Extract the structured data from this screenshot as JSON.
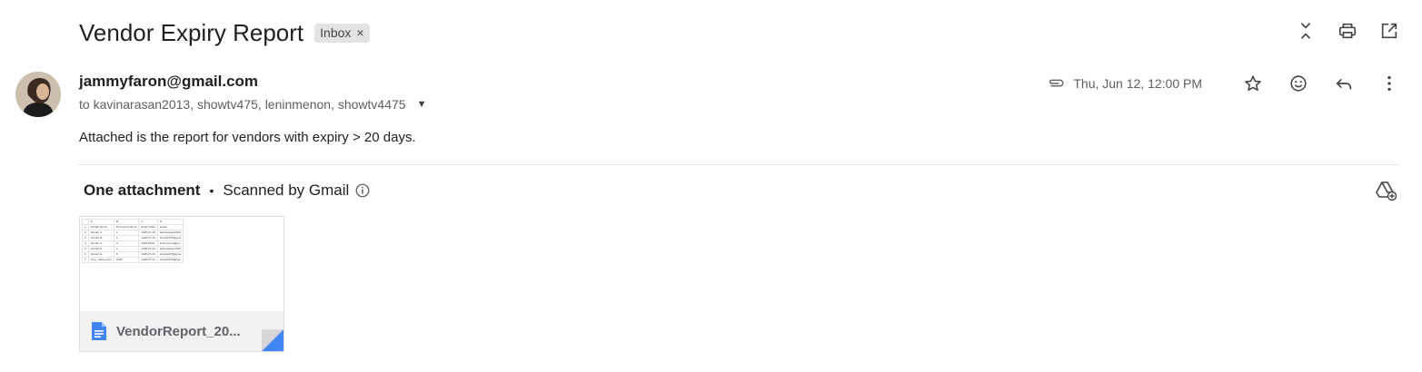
{
  "email": {
    "subject": "Vendor Expiry Report",
    "label": "Inbox",
    "label_remove": "×",
    "sender": "jammyfaron@gmail.com",
    "recipients": "to kavinarasan2013, showtv475, leninmenon, showtv4475",
    "date": "Thu, Jun 12, 12:00 PM",
    "body": "Attached is the report for vendors with expiry > 20 days."
  },
  "attachments": {
    "count_label": "One attachment",
    "separator": "•",
    "scanned_label": "Scanned by Gmail",
    "file_name": "VendorReport_20...",
    "preview": {
      "col_headers": [
        "",
        "A",
        "B",
        "C",
        "D"
      ],
      "rows": [
        [
          "1",
          "Vendor Name",
          "Document Numb",
          "Expiry Date",
          "Email"
        ],
        [
          "2",
          "Vendor A",
          "1",
          "2025-07-18",
          "kavinarasan2013"
        ],
        [
          "3",
          "Vendor B",
          "2",
          "2025-07-19",
          "showtv475@gma"
        ],
        [
          "4",
          "Vendor C",
          "3",
          "2025-08-01",
          "leninmenon@gm"
        ],
        [
          "5",
          "Vendor D",
          "4",
          "2025-07-15",
          "kavinarasan2013"
        ],
        [
          "6",
          "Vendor E",
          "5",
          "2025-07-20",
          "showtv475@gma"
        ],
        [
          "7",
          "Tony_Stark-prAnt",
          "1000",
          "2025-07-11",
          "showtv4475@gm"
        ]
      ]
    }
  },
  "icons": {
    "collapse": "collapse-all-icon",
    "print": "print-icon",
    "open_new": "open-in-new-window-icon",
    "attachment": "paperclip-icon",
    "star": "star-icon",
    "emoji": "emoji-icon",
    "reply": "reply-icon",
    "more": "more-vert-icon",
    "info": "info-icon",
    "add_to_drive": "add-to-drive-icon",
    "doc": "google-docs-icon"
  },
  "colors": {
    "docs_blue": "#4285f4",
    "chip_bg": "#e3e3e3"
  }
}
